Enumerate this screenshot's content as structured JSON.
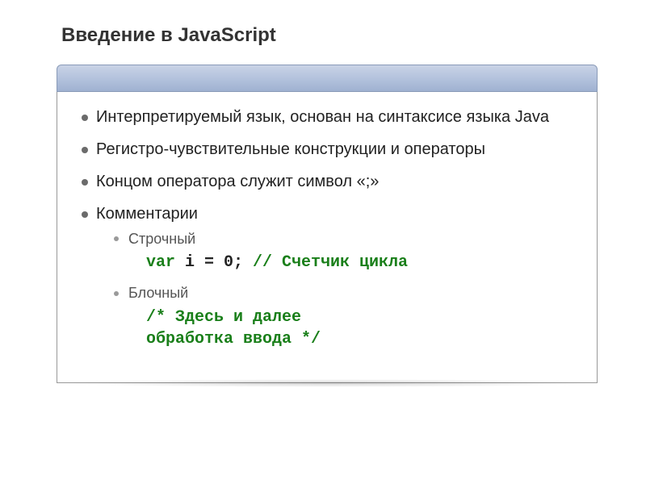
{
  "title": "Введение в JavaScript",
  "bullets": {
    "b1": "Интерпретируемый язык, основан на синтаксисе языка Java",
    "b2": "Регистро-чувствительные конструкции и операторы",
    "b3": "Концом оператора служит символ «;»",
    "b4": "Комментарии"
  },
  "sub": {
    "s1": "Строчный",
    "s2": "Блочный"
  },
  "code1": {
    "kw": "var",
    "stmt": " i = 0; ",
    "comment": "// Счетчик цикла"
  },
  "code2": {
    "comment": "/* Здесь и далее\nобработка ввода */"
  }
}
